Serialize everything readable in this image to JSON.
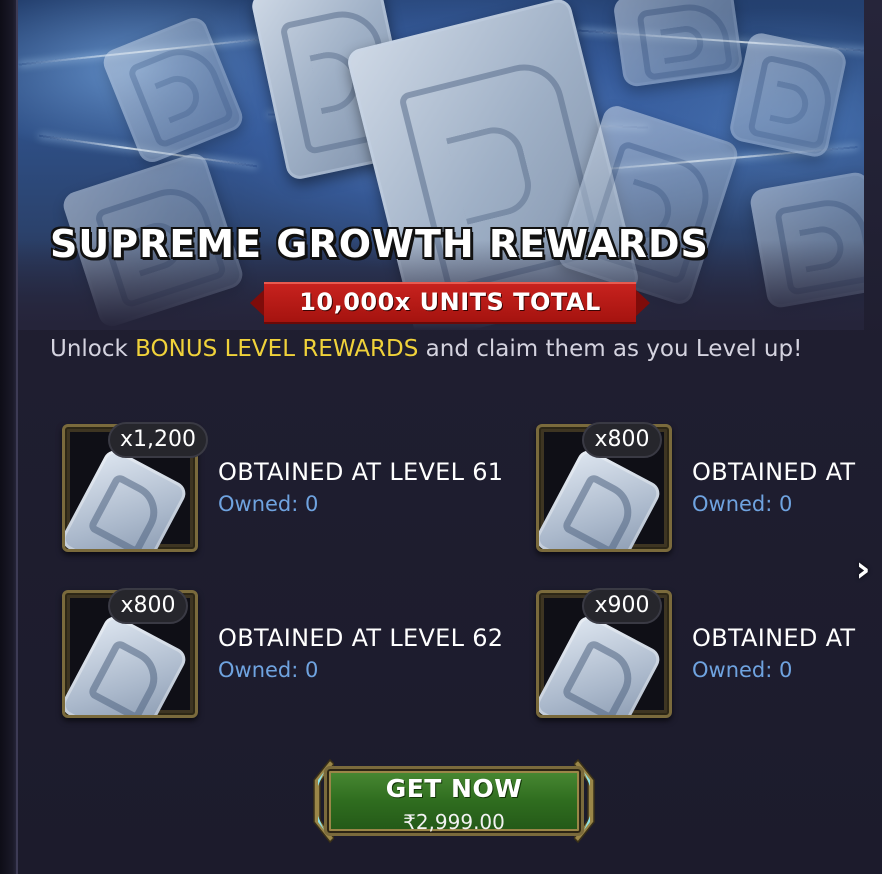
{
  "banner": {
    "title": "SUPREME GROWTH REWARDS",
    "ribbon": "10,000x UNITS TOTAL"
  },
  "description": {
    "prefix": "Unlock ",
    "highlight": "BONUS LEVEL REWARDS",
    "suffix": " and claim them as you Level up!"
  },
  "rewards": [
    {
      "quantity": "x1,200",
      "title": "OBTAINED AT LEVEL 61",
      "owned": "Owned: 0",
      "icon": "unit-card-icon"
    },
    {
      "quantity": "x800",
      "title": "OBTAINED AT LEVEL 62",
      "owned": "Owned: 0",
      "icon": "unit-card-icon"
    },
    {
      "quantity": "x800",
      "title": "OBTAINED AT",
      "owned": "Owned: 0",
      "icon": "unit-card-icon"
    },
    {
      "quantity": "x900",
      "title": "OBTAINED AT",
      "owned": "Owned: 0",
      "icon": "unit-card-icon"
    }
  ],
  "next_icon": "chevron-right-icon",
  "purchase": {
    "label": "GET NOW",
    "price": "₹2,999.00"
  },
  "colors": {
    "highlight": "#f0d23a",
    "owned": "#6fa3e0",
    "ribbon": "#b51a16",
    "button": "#2f6d1f",
    "frame_gold": "#7a6a3c"
  }
}
